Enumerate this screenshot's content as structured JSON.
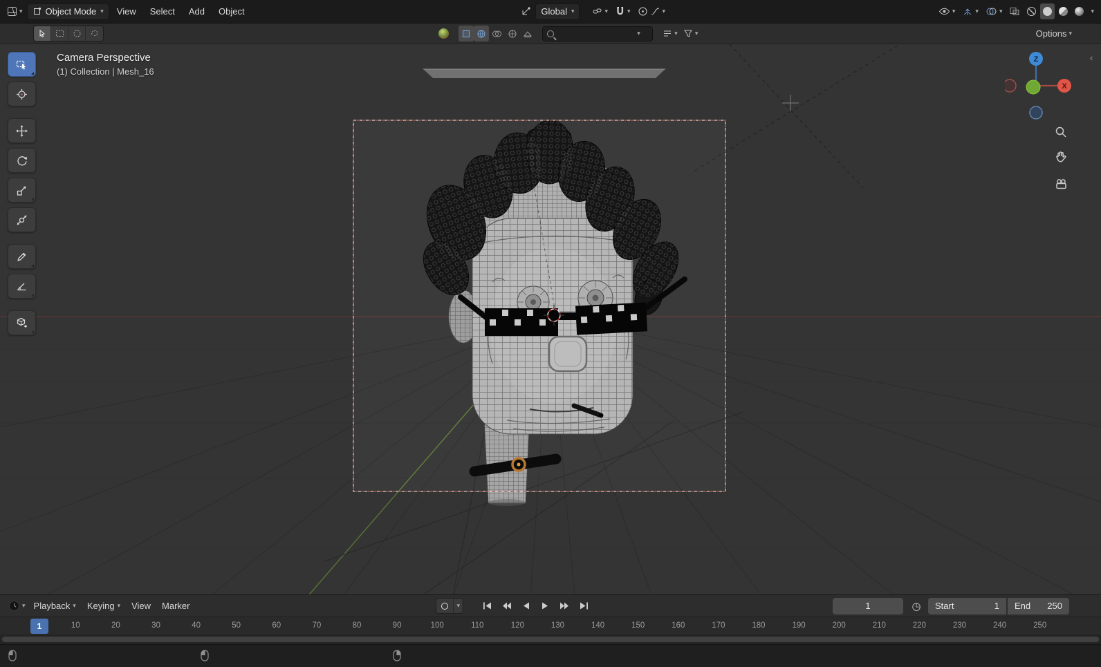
{
  "topbar": {
    "mode": "Object Mode",
    "menus": [
      "View",
      "Select",
      "Add",
      "Object"
    ],
    "orientation": "Global"
  },
  "header2": {
    "options_label": "Options"
  },
  "viewport": {
    "overlay_line1": "Camera Perspective",
    "overlay_line2": "(1) Collection | Mesh_16",
    "gizmo": {
      "z": "Z",
      "x": "X"
    }
  },
  "timeline": {
    "menus": [
      "Playback",
      "Keying",
      "View",
      "Marker"
    ],
    "frame_field": "1",
    "current_frame": "1",
    "start_label": "Start",
    "start_value": "1",
    "end_label": "End",
    "end_value": "250",
    "ticks": [
      "10",
      "20",
      "30",
      "40",
      "50",
      "60",
      "70",
      "80",
      "90",
      "100",
      "110",
      "120",
      "130",
      "140",
      "150",
      "160",
      "170",
      "180",
      "190",
      "200",
      "210",
      "220",
      "230",
      "240",
      "250"
    ]
  },
  "glyphs": {
    "chevron": "▾",
    "clock": "◷",
    "edge_arrow": "‹"
  },
  "colors": {
    "accent": "#4772b3",
    "axis_x": "#e05548",
    "axis_y": "#71a833",
    "axis_z": "#3e8ad6",
    "camera_border": "#c06055"
  }
}
